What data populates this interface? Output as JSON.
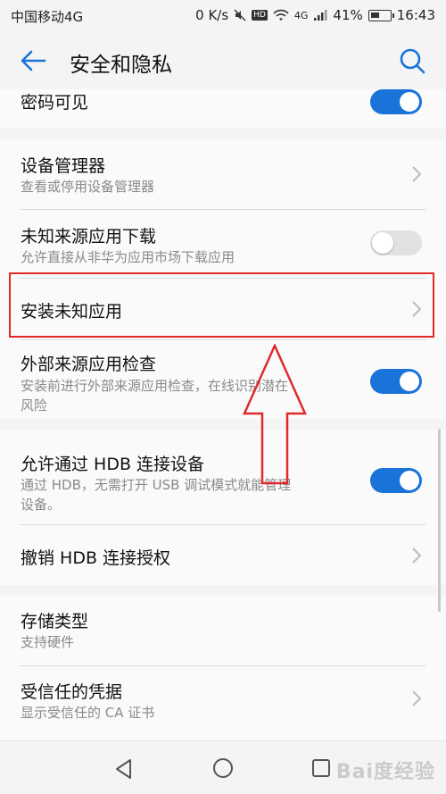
{
  "status_bar": {
    "carrier": "中国移动4G",
    "speed": "0 K/s",
    "hd": "HD",
    "network": "4G",
    "battery": "41%",
    "time": "16:43"
  },
  "app_bar": {
    "title": "安全和隐私"
  },
  "rows": {
    "password_visible": {
      "title": "密码可见",
      "toggle": "on"
    },
    "device_admin": {
      "title": "设备管理器",
      "subtitle": "查看或停用设备管理器"
    },
    "unknown_sources_download": {
      "title": "未知来源应用下载",
      "subtitle": "允许直接从非华为应用市场下载应用",
      "toggle": "off"
    },
    "install_unknown_apps": {
      "title": "安装未知应用"
    },
    "external_app_check": {
      "title": "外部来源应用检查",
      "subtitle_line1": "安装前进行外部来源应用检查，在线识别潜在",
      "subtitle_line2": "风险",
      "toggle": "on"
    },
    "allow_hdb": {
      "title": "允许通过 HDB 连接设备",
      "subtitle_line1": "通过 HDB，无需打开 USB 调试模式就能管理",
      "subtitle_line2": "设备。",
      "toggle": "on"
    },
    "revoke_hdb": {
      "title": "撤销 HDB 连接授权"
    },
    "storage_type": {
      "title": "存储类型",
      "subtitle": "支持硬件"
    },
    "trusted_credentials": {
      "title": "受信任的凭据",
      "subtitle": "显示受信任的 CA 证书"
    }
  },
  "watermark": "Bai度经验",
  "colors": {
    "accent": "#1a73d9",
    "highlight": "#e02a2a"
  }
}
